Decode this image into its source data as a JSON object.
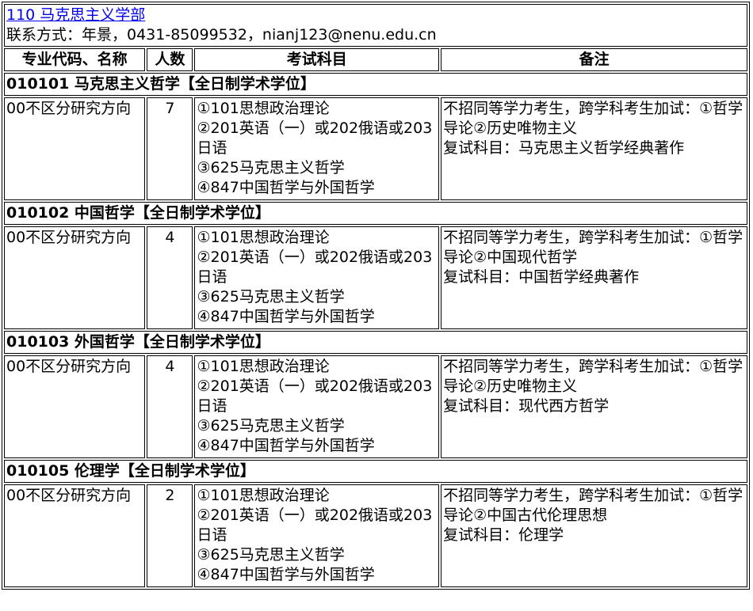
{
  "header": {
    "department": "110 马克思主义学部",
    "contact": "联系方式：年景，0431-85099532，nianj123@nenu.edu.cn"
  },
  "columns": {
    "major": "专业代码、名称",
    "count": "人数",
    "subjects": "考试科目",
    "notes": "备注"
  },
  "majors": [
    {
      "title": "010101 马克思主义哲学【全日制学术学位】",
      "direction": "00不区分研究方向",
      "count": "7",
      "subjects": [
        "①101思想政治理论",
        "②201英语（一）或202俄语或203日语",
        "③625马克思主义哲学",
        "④847中国哲学与外国哲学"
      ],
      "notes": [
        "不招同等学力考生，跨学科考生加试：①哲学导论②历史唯物主义",
        "复试科目：马克思主义哲学经典著作"
      ]
    },
    {
      "title": "010102 中国哲学【全日制学术学位】",
      "direction": "00不区分研究方向",
      "count": "4",
      "subjects": [
        "①101思想政治理论",
        "②201英语（一）或202俄语或203日语",
        "③625马克思主义哲学",
        "④847中国哲学与外国哲学"
      ],
      "notes": [
        "不招同等学力考生，跨学科考生加试：①哲学导论②中国现代哲学",
        "复试科目：中国哲学经典著作"
      ]
    },
    {
      "title": "010103 外国哲学【全日制学术学位】",
      "direction": "00不区分研究方向",
      "count": "4",
      "subjects": [
        "①101思想政治理论",
        "②201英语（一）或202俄语或203日语",
        "③625马克思主义哲学",
        "④847中国哲学与外国哲学"
      ],
      "notes": [
        "不招同等学力考生，跨学科考生加试：①哲学导论②历史唯物主义",
        "复试科目：现代西方哲学"
      ]
    },
    {
      "title": "010105 伦理学【全日制学术学位】",
      "direction": "00不区分研究方向",
      "count": "2",
      "subjects": [
        "①101思想政治理论",
        "②201英语（一）或202俄语或203日语",
        "③625马克思主义哲学",
        "④847中国哲学与外国哲学"
      ],
      "notes": [
        "不招同等学力考生，跨学科考生加试：①哲学导论②中国古代伦理思想",
        "复试科目：伦理学"
      ]
    }
  ]
}
